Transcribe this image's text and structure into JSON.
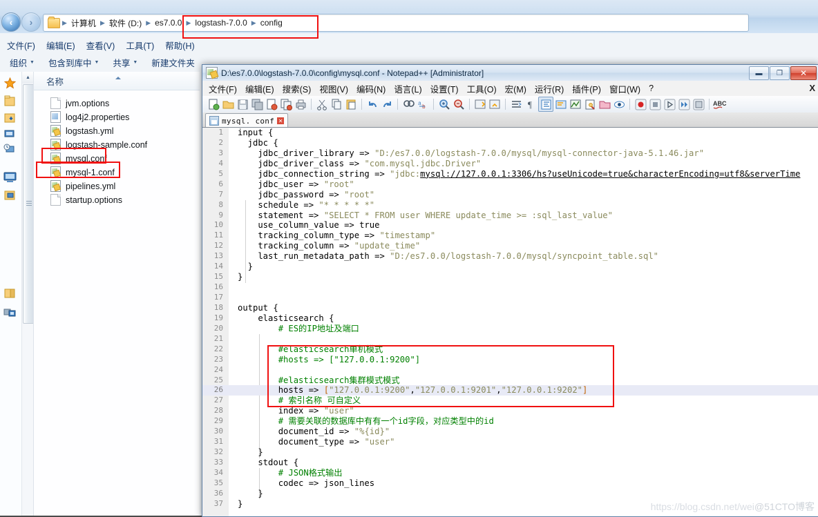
{
  "explorer": {
    "nav": {
      "back_icon": "back-arrow-icon",
      "forward_icon": "forward-arrow-icon",
      "dropdown_icon": "chevron-down-icon"
    },
    "breadcrumbs": [
      {
        "label": "计算机"
      },
      {
        "label": "软件 (D:)"
      },
      {
        "label": "es7.0.0"
      },
      {
        "label": "logstash-7.0.0"
      },
      {
        "label": "config"
      }
    ],
    "menus": [
      {
        "label": "文件(F)"
      },
      {
        "label": "编辑(E)"
      },
      {
        "label": "查看(V)"
      },
      {
        "label": "工具(T)"
      },
      {
        "label": "帮助(H)"
      }
    ],
    "toolbar": [
      {
        "label": "组织",
        "has_caret": true
      },
      {
        "label": "包含到库中",
        "has_caret": true
      },
      {
        "label": "共享",
        "has_caret": true
      },
      {
        "label": "新建文件夹",
        "has_caret": false
      }
    ],
    "column_header": "名称",
    "files": [
      {
        "name": "jvm.options",
        "icon": "plain-file-icon",
        "highlighted": false
      },
      {
        "name": "log4j2.properties",
        "icon": "properties-file-icon",
        "highlighted": false
      },
      {
        "name": "logstash.yml",
        "icon": "conf-file-icon",
        "highlighted": false
      },
      {
        "name": "logstash-sample.conf",
        "icon": "conf-file-icon",
        "highlighted": false
      },
      {
        "name": "mysql.conf",
        "icon": "conf-file-icon",
        "highlighted": true
      },
      {
        "name": "mysql-1.conf",
        "icon": "conf-file-icon",
        "highlighted": true
      },
      {
        "name": "pipelines.yml",
        "icon": "conf-file-icon",
        "highlighted": false
      },
      {
        "name": "startup.options",
        "icon": "plain-file-icon",
        "highlighted": false
      }
    ]
  },
  "notepad": {
    "title": "D:\\es7.0.0\\logstash-7.0.0\\config\\mysql.conf - Notepad++ [Administrator]",
    "window_buttons": {
      "minimize": "—",
      "restore": "❐",
      "close": "✕"
    },
    "menus": [
      {
        "label": "文件(F)"
      },
      {
        "label": "编辑(E)"
      },
      {
        "label": "搜索(S)"
      },
      {
        "label": "视图(V)"
      },
      {
        "label": "编码(N)"
      },
      {
        "label": "语言(L)"
      },
      {
        "label": "设置(T)"
      },
      {
        "label": "工具(O)"
      },
      {
        "label": "宏(M)"
      },
      {
        "label": "运行(R)"
      },
      {
        "label": "插件(P)"
      },
      {
        "label": "窗口(W)"
      },
      {
        "label": "?"
      }
    ],
    "menu_close": "X",
    "tab": {
      "label": "mysql. conf",
      "close": "✕"
    },
    "current_line": 26,
    "code_lines": [
      {
        "n": 1,
        "text": "input {"
      },
      {
        "n": 2,
        "text": "  jdbc {"
      },
      {
        "n": 3,
        "text": "    jdbc_driver_library => \"D:/es7.0.0/logstash-7.0.0/mysql/mysql-connector-java-5.1.46.jar\""
      },
      {
        "n": 4,
        "text": "    jdbc_driver_class => \"com.mysql.jdbc.Driver\""
      },
      {
        "n": 5,
        "text": "    jdbc_connection_string => \"jdbc:mysql://127.0.0.1:3306/hs?useUnicode=true&characterEncoding=utf8&serverTime"
      },
      {
        "n": 6,
        "text": "    jdbc_user => \"root\""
      },
      {
        "n": 7,
        "text": "    jdbc_password => \"root\""
      },
      {
        "n": 8,
        "text": "    schedule => \"* * * * *\""
      },
      {
        "n": 9,
        "text": "    statement => \"SELECT * FROM user WHERE update_time >= :sql_last_value\""
      },
      {
        "n": 10,
        "text": "    use_column_value => true"
      },
      {
        "n": 11,
        "text": "    tracking_column_type => \"timestamp\""
      },
      {
        "n": 12,
        "text": "    tracking_column => \"update_time\""
      },
      {
        "n": 13,
        "text": "    last_run_metadata_path => \"D:/es7.0.0/logstash-7.0.0/mysql/syncpoint_table.sql\""
      },
      {
        "n": 14,
        "text": "  }"
      },
      {
        "n": 15,
        "text": "}"
      },
      {
        "n": 16,
        "text": ""
      },
      {
        "n": 17,
        "text": ""
      },
      {
        "n": 18,
        "text": "output {"
      },
      {
        "n": 19,
        "text": "    elasticsearch {"
      },
      {
        "n": 20,
        "text": "        # ES的IP地址及端口"
      },
      {
        "n": 21,
        "text": ""
      },
      {
        "n": 22,
        "text": "        #elasticsearch单机模式"
      },
      {
        "n": 23,
        "text": "        #hosts => [\"127.0.0.1:9200\"]"
      },
      {
        "n": 24,
        "text": ""
      },
      {
        "n": 25,
        "text": "        #elasticsearch集群模式模式"
      },
      {
        "n": 26,
        "text": "        hosts => [\"127.0.0.1:9200\",\"127.0.0.1:9201\",\"127.0.0.1:9202\"]"
      },
      {
        "n": 27,
        "text": "        # 索引名称 可自定义"
      },
      {
        "n": 28,
        "text": "        index => \"user\""
      },
      {
        "n": 29,
        "text": "        # 需要关联的数据库中有有一个id字段，对应类型中的id"
      },
      {
        "n": 30,
        "text": "        document_id => \"%{id}\""
      },
      {
        "n": 31,
        "text": "        document_type => \"user\""
      },
      {
        "n": 32,
        "text": "    }"
      },
      {
        "n": 33,
        "text": "    stdout {"
      },
      {
        "n": 34,
        "text": "        # JSON格式输出"
      },
      {
        "n": 35,
        "text": "        codec => json_lines"
      },
      {
        "n": 36,
        "text": "    }"
      },
      {
        "n": 37,
        "text": "}"
      }
    ]
  },
  "annotations": {
    "color": "#f01010",
    "boxes": [
      {
        "name": "breadcrumb-highlight"
      },
      {
        "name": "mysql-conf-highlight"
      },
      {
        "name": "mysql-1-conf-highlight"
      },
      {
        "name": "cluster-hosts-highlight"
      }
    ]
  },
  "watermarks": {
    "csdn": "https://blog.csdn.net/wei",
    "cto": "@51CTO博客"
  }
}
